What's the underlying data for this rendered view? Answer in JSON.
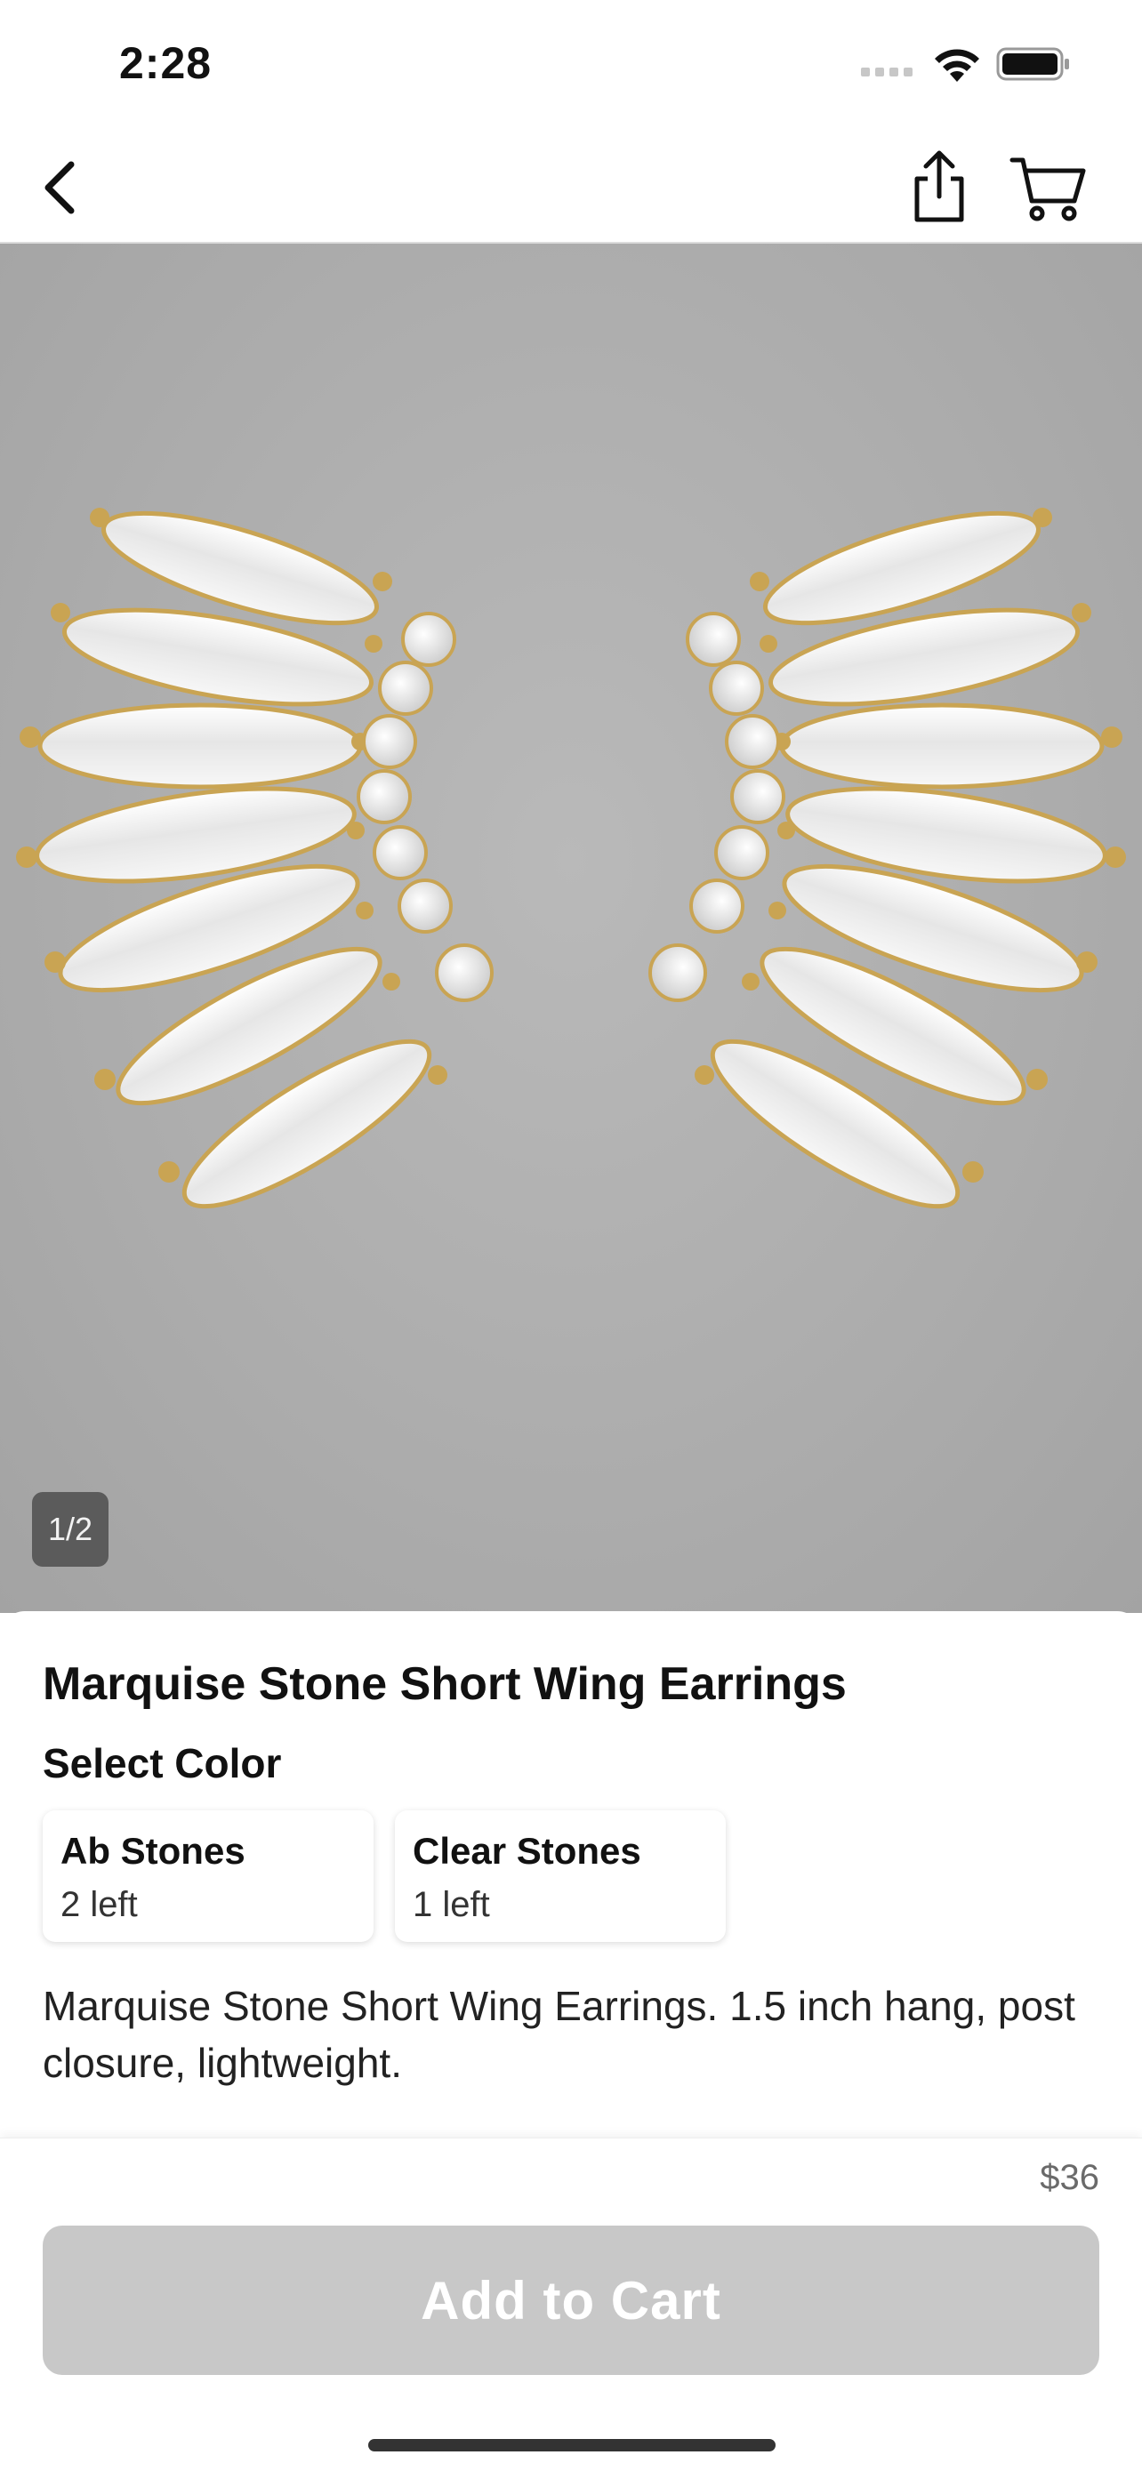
{
  "status_bar": {
    "time": "2:28"
  },
  "nav": {
    "back_icon": "chevron-left-icon",
    "share_icon": "share-icon",
    "cart_icon": "cart-icon"
  },
  "gallery": {
    "counter": "1/2",
    "image_alt": "Marquise stone short wing earrings on gray background"
  },
  "product": {
    "title": "Marquise Stone Short Wing Earrings",
    "select_color_label": "Select Color",
    "options": [
      {
        "name": "Ab Stones",
        "stock": "2 left"
      },
      {
        "name": "Clear Stones",
        "stock": "1 left"
      }
    ],
    "description": "Marquise Stone Short Wing Earrings. 1.5 inch hang, post closure, lightweight."
  },
  "footer": {
    "price": "$36",
    "add_to_cart": "Add to Cart"
  },
  "colors": {
    "button_disabled": "#c8c8c8",
    "hero_bg": "#acacac",
    "gold": "#c9a453"
  }
}
